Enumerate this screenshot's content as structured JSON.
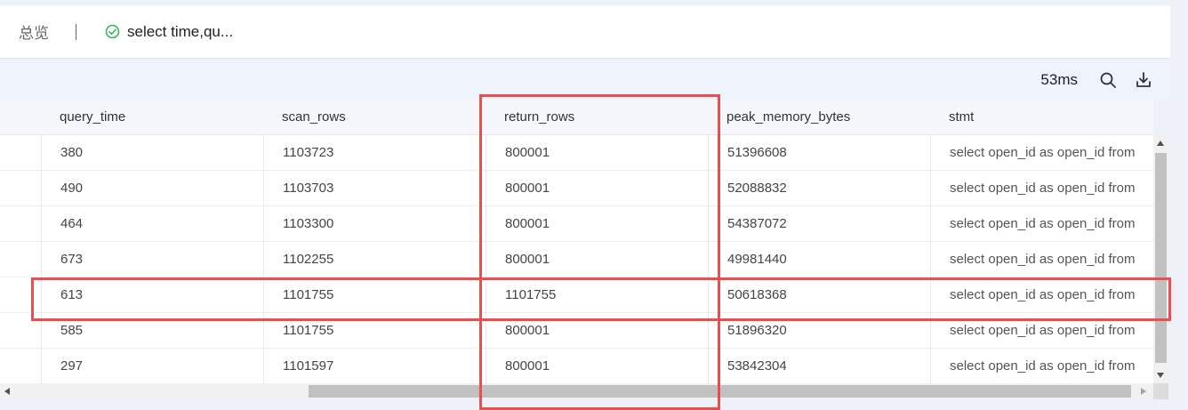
{
  "tabs": {
    "overview_label": "总览",
    "query_label": "select time,qu..."
  },
  "toolbar": {
    "elapsed": "53ms"
  },
  "icons": {
    "status": "check-circle-icon",
    "search": "search-icon",
    "download": "download-icon"
  },
  "colors": {
    "success": "#3bb55e",
    "highlight": "#e8504f"
  },
  "table": {
    "columns": [
      "query_time",
      "scan_rows",
      "return_rows",
      "peak_memory_bytes",
      "stmt"
    ],
    "rows": [
      {
        "query_time": "380",
        "scan_rows": "1103723",
        "return_rows": "800001",
        "peak_memory_bytes": "51396608",
        "stmt": "select open_id as open_id from"
      },
      {
        "query_time": "490",
        "scan_rows": "1103703",
        "return_rows": "800001",
        "peak_memory_bytes": "52088832",
        "stmt": "select open_id as open_id from"
      },
      {
        "query_time": "464",
        "scan_rows": "1103300",
        "return_rows": "800001",
        "peak_memory_bytes": "54387072",
        "stmt": "select open_id as open_id from"
      },
      {
        "query_time": "673",
        "scan_rows": "1102255",
        "return_rows": "800001",
        "peak_memory_bytes": "49981440",
        "stmt": "select open_id as open_id from"
      },
      {
        "query_time": "613",
        "scan_rows": "1101755",
        "return_rows": "1101755",
        "peak_memory_bytes": "50618368",
        "stmt": "select open_id as open_id from"
      },
      {
        "query_time": "585",
        "scan_rows": "1101755",
        "return_rows": "800001",
        "peak_memory_bytes": "51896320",
        "stmt": "select open_id as open_id from"
      },
      {
        "query_time": "297",
        "scan_rows": "1101597",
        "return_rows": "800001",
        "peak_memory_bytes": "53842304",
        "stmt": "select open_id as open_id from"
      }
    ]
  }
}
